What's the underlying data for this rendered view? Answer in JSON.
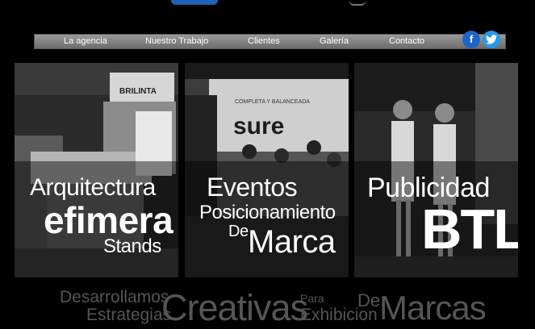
{
  "nav": {
    "items": [
      "La agencia",
      "Nuestro Trabajo",
      "Clientes",
      "Galería",
      "Contacto"
    ]
  },
  "social": {
    "facebook_glyph": "f",
    "twitter_glyph": "t"
  },
  "panels": [
    {
      "line1": "Arquitectura",
      "line2": "efimera",
      "line3": "Stands",
      "sign_text": "BRILINTA"
    },
    {
      "line1": "Eventos",
      "line2": "Posicionamiento",
      "line3": "De",
      "line4": "Marca",
      "banner_text": "sure",
      "banner_small": "COMPLETA Y BALANCEADA"
    },
    {
      "line1": "Publicidad",
      "line2": "BTL"
    }
  ],
  "tagline": {
    "w1": "Desarrollamos",
    "w2": "Estrategias",
    "w3": "Creativas",
    "w4": "Para",
    "w5": "Exhibicion",
    "w6": "De",
    "w7": "Marcas"
  },
  "colors": {
    "facebook": "#1f64c8",
    "twitter": "#2a98e6",
    "brand_blue": "#1e63b8"
  }
}
